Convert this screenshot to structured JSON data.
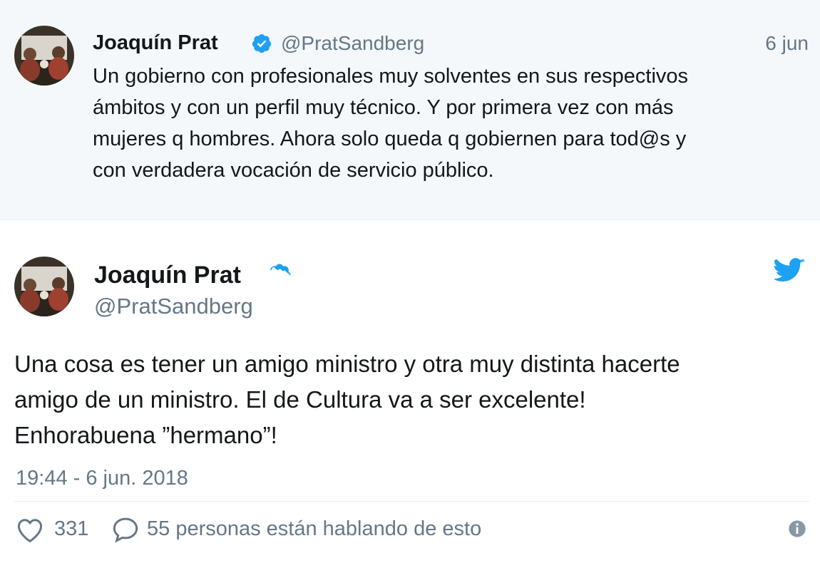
{
  "tweet_top": {
    "author_name": "Joaquín Prat",
    "handle": "@PratSandberg",
    "date": "6 jun",
    "text_lines": [
      "Un gobierno con profesionales muy solventes en sus respectivos",
      "ámbitos y con un perfil muy técnico. Y por primera vez con más",
      "mujeres q hombres. Ahora solo queda q gobiernen para tod@s y",
      "con verdadera vocación de servicio público."
    ]
  },
  "tweet_main": {
    "author_name": "Joaquín Prat",
    "handle": "@PratSandberg",
    "text_lines": [
      "Una cosa es tener un amigo ministro y otra muy distinta hacerte",
      "amigo de un ministro. El de Cultura va a ser excelente!",
      "Enhorabuena ”hermano”!"
    ],
    "timestamp": "19:44 - 6 jun. 2018",
    "likes": "331",
    "talking": "55 personas están hablando de esto"
  },
  "icons": {
    "verified": "verified-badge-icon",
    "bird": "twitter-bird-icon",
    "heart": "heart-icon",
    "reply": "reply-bubble-icon",
    "info": "info-icon"
  },
  "colors": {
    "accent": "#1da1f2",
    "muted": "#657786",
    "text": "#14171a",
    "top_bg": "#f5f8fa"
  }
}
